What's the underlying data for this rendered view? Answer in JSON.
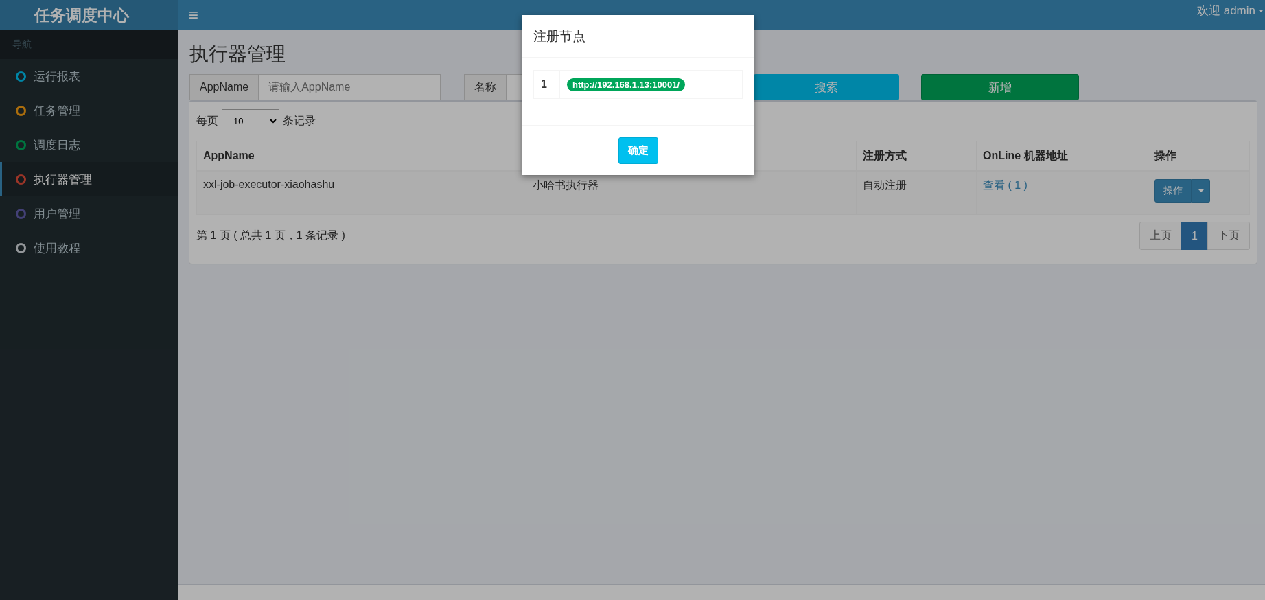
{
  "sidebar": {
    "logo": "任务调度中心",
    "section_label": "导航",
    "items": [
      {
        "label": "运行报表",
        "color": "#0086a7",
        "selected": false
      },
      {
        "label": "任务管理",
        "color": "#aa6d0d",
        "selected": false
      },
      {
        "label": "调度日志",
        "color": "#00743f",
        "selected": false
      },
      {
        "label": "执行器管理",
        "color": "#9b3528",
        "selected": true
      },
      {
        "label": "用户管理",
        "color": "#434076",
        "selected": false
      },
      {
        "label": "使用教程",
        "color": "#939699",
        "selected": false
      }
    ]
  },
  "header": {
    "menu_icon": "≡",
    "user": "欢迎 admin"
  },
  "page_title": "执行器管理",
  "filters": [
    {
      "label": "AppName",
      "placeholder": "请输入AppName"
    },
    {
      "label": "名称"
    }
  ],
  "buttons": {
    "search": "搜索",
    "add": "新增"
  },
  "page_size": {
    "before": "每页",
    "value": "10",
    "after": "条记录"
  },
  "table": {
    "columns": [
      {
        "label": "AppName"
      },
      {},
      {
        "label": "注册方式"
      },
      {
        "label": "OnLine 机器地址"
      },
      {
        "label": "操作"
      }
    ],
    "rows": [
      {
        "app_name": "xxl-job-executor-xiaohashu",
        "title": "小哈书执行器",
        "register_type": "自动注册",
        "online": "查看 ( 1 )",
        "action": "操作"
      }
    ]
  },
  "summary": "第 1 页 ( 总共 1 页，1 条记录 )",
  "pagination": [
    {
      "label": "上页",
      "selected": false
    },
    {
      "label": "1",
      "selected": true
    },
    {
      "label": "下页",
      "selected": false
    }
  ],
  "modal": {
    "title": "注册节点",
    "rows": [
      {
        "index": "1",
        "address": "http://192.168.1.13:10001/"
      }
    ],
    "ok": "确定"
  }
}
